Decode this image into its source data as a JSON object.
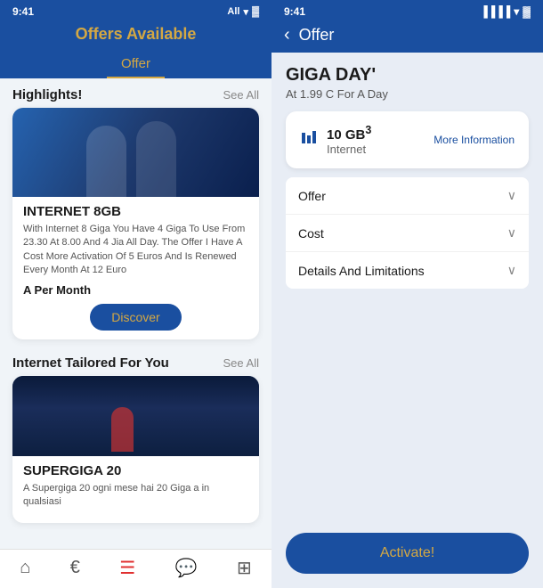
{
  "left": {
    "status": {
      "time": "9:41",
      "carrier": "All",
      "battery": "█████"
    },
    "header": {
      "title": "Offers Available"
    },
    "tab": {
      "label": "Offer"
    },
    "highlights": {
      "section_title": "Highlights!",
      "see_all": "See All"
    },
    "offer1": {
      "name": "INTERNET 8GB",
      "description": "With Internet 8 Giga You Have 4 Giga To Use From 23.30 At 8.00 And 4 Jia All Day. The Offer I Have A Cost More Activation Of 5 Euros And Is Renewed Every Month At 12 Euro",
      "price": "A Per Month",
      "button": "Discover"
    },
    "section2": {
      "title": "Internet Tailored For You",
      "see_all": "See All"
    },
    "offer2": {
      "name": "SUPERGIGA 20",
      "description": "A Supergiga 20 ogni mese hai 20 Giga a in qualsiasi"
    }
  },
  "right": {
    "status": {
      "time": "9:41",
      "signal": "▐▐▐▐",
      "battery": "█████"
    },
    "header": {
      "back": "‹",
      "title": "Offer"
    },
    "giga": {
      "title": "GIGA DAY'",
      "subtitle": "At 1.99 C For A Day",
      "amount": "10 GB",
      "superscript": "3",
      "type": "Internet",
      "more_info": "More Information"
    },
    "accordion": {
      "items": [
        {
          "label": "Offer"
        },
        {
          "label": "Cost"
        },
        {
          "label": "Details And Limitations"
        }
      ]
    },
    "activate": {
      "label": "Activate!"
    }
  },
  "bottom_nav": {
    "items": [
      {
        "icon": "⌂",
        "label": "home",
        "active": false
      },
      {
        "icon": "€",
        "label": "euro",
        "active": false
      },
      {
        "icon": "☰",
        "label": "menu",
        "active": true
      },
      {
        "icon": "💬",
        "label": "chat",
        "active": false
      },
      {
        "icon": "⊞",
        "label": "grid",
        "active": false
      }
    ]
  }
}
